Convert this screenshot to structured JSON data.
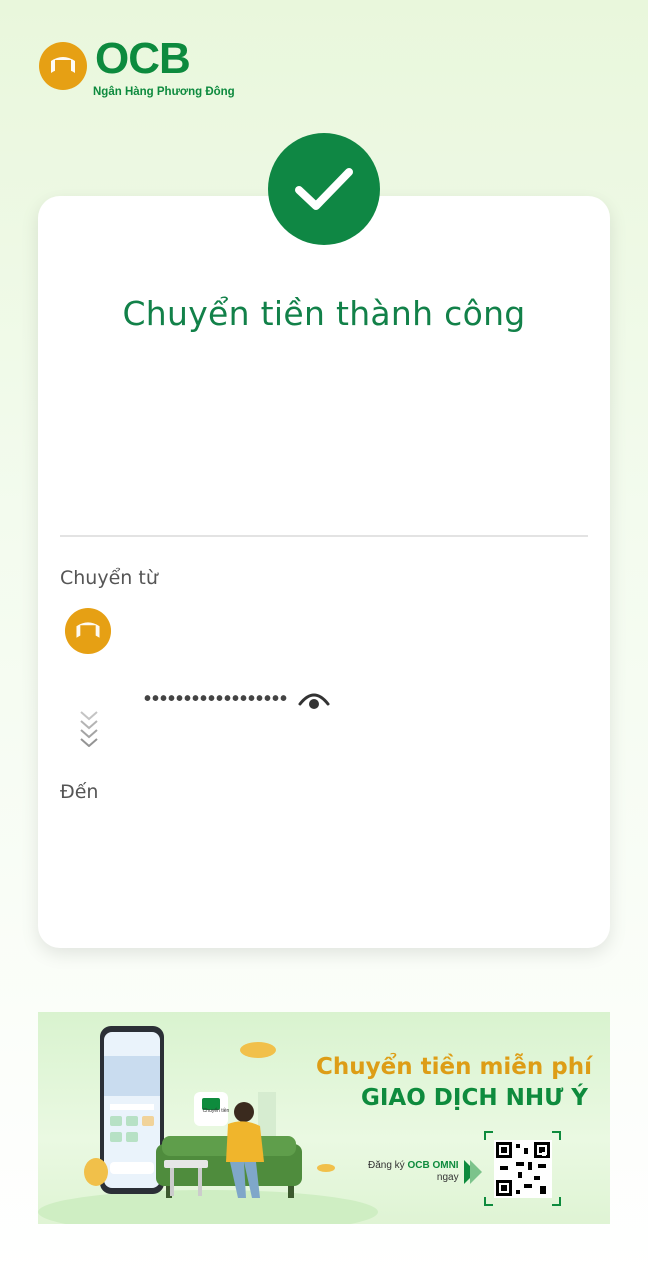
{
  "brand": {
    "logo_text": "OCB",
    "logo_subtitle": "Ngân Hàng Phương Đông",
    "green": "#0f8744",
    "gold": "#e6a014"
  },
  "result": {
    "status_icon": "check-icon",
    "title": "Chuyển tiền thành công"
  },
  "transfer": {
    "from_label": "Chuyển từ",
    "account_masked": "••••••••••••••••••",
    "toggle_icon": "eye-icon",
    "to_label": "Đến"
  },
  "banner": {
    "line1": "Chuyển tiền miễn phí",
    "line2": "GIAO DỊCH NHƯ Ý",
    "register_prefix": "Đăng ký",
    "register_app": "OCB OMNI",
    "register_suffix": "ngay",
    "phone_feature_label": "Chuyển tiền"
  }
}
